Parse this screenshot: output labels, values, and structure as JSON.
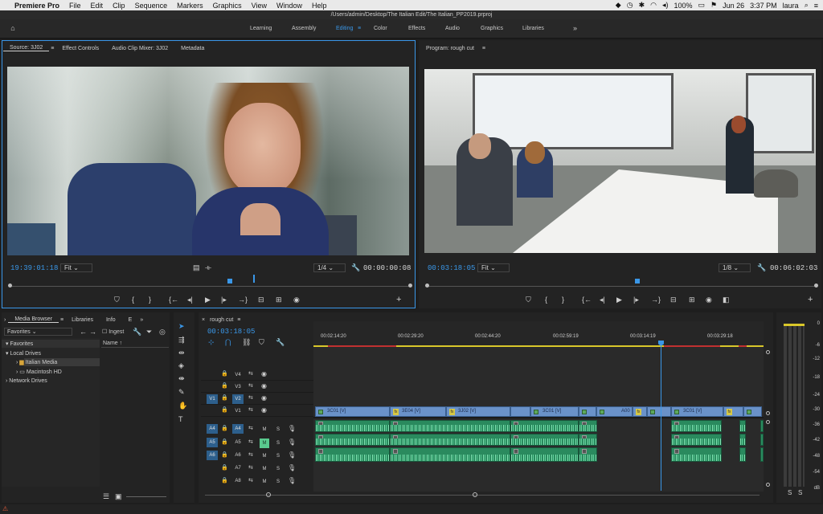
{
  "menubar": {
    "apple": "",
    "app": "Premiere Pro",
    "items": [
      "File",
      "Edit",
      "Clip",
      "Sequence",
      "Markers",
      "Graphics",
      "View",
      "Window",
      "Help"
    ],
    "battery": "100%",
    "date": "Jun 26",
    "time": "3:37 PM",
    "user": "laura"
  },
  "window": {
    "path": "/Users/admin/Desktop/The Italian Edit/The Italian_PP2019.prproj"
  },
  "workspaces": {
    "items": [
      "Learning",
      "Assembly",
      "Editing",
      "Color",
      "Effects",
      "Audio",
      "Graphics",
      "Libraries"
    ],
    "active": "Editing",
    "more": "»"
  },
  "source": {
    "tabs": [
      "Source: 3J02",
      "Effect Controls",
      "Audio Clip Mixer: 3J02",
      "Metadata"
    ],
    "timecode": "19:39:01:18",
    "fit": "Fit",
    "resolution": "1/4",
    "duration": "00:00:00:08"
  },
  "program": {
    "tab": "Program: rough cut",
    "timecode": "00:03:18:05",
    "fit": "Fit",
    "resolution": "1/8",
    "duration": "00:06:02:03"
  },
  "project": {
    "tabs": [
      "Media Browser",
      "Libraries",
      "Info",
      "E"
    ],
    "favorites_select": "Favorites",
    "ingest": "Ingest",
    "column": "Name ↑",
    "tree": [
      "Favorites",
      "Local Drives",
      "Italian Media",
      "Macintosh HD",
      "Network Drives"
    ]
  },
  "timeline": {
    "tab": "rough cut",
    "timecode": "00:03:18:05",
    "ruler": [
      "00:02:14:20",
      "00:02:29:20",
      "00:02:44:20",
      "00:02:59:19",
      "00:03:14:19",
      "00:03:29:18"
    ],
    "video_tracks": [
      "V4",
      "V3",
      "V2",
      "V1"
    ],
    "audio_tracks": [
      "A4",
      "A5",
      "A6",
      "A7",
      "A8"
    ],
    "source_patch_video": "V1",
    "source_patch_audio": [
      "A4",
      "A5",
      "A6"
    ],
    "mute_label": "M",
    "solo_label": "S",
    "clips": [
      "3C01 [V]",
      "3E04 [V]",
      "3J02 [V]",
      "3C01 [V]",
      "A00",
      "3C01 [V]"
    ]
  },
  "meter": {
    "labels": [
      "0",
      "-6",
      "-12",
      "-18",
      "-24",
      "-30",
      "-36",
      "-42",
      "-48",
      "-54",
      "dB"
    ]
  },
  "colors": {
    "accent": "#3a97e8",
    "video_clip": "#6a92c9",
    "audio_clip": "#2a8a5e"
  }
}
